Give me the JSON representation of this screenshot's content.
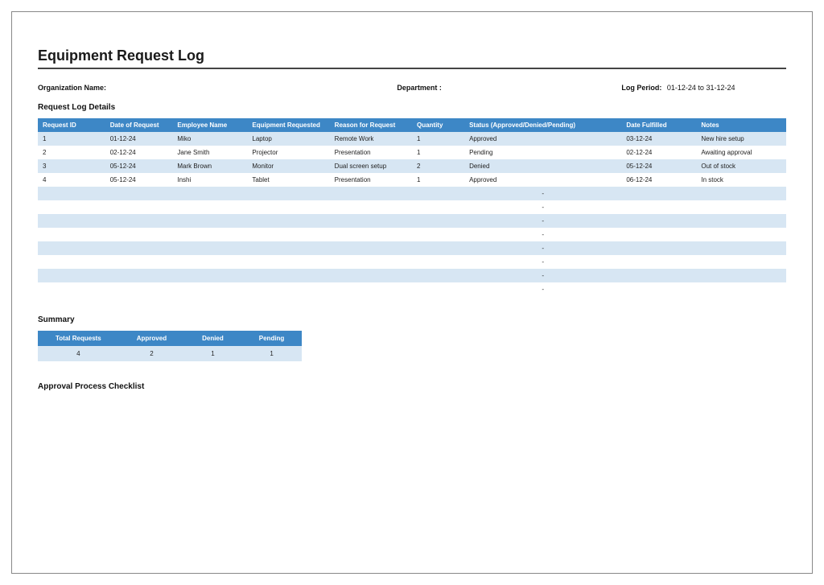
{
  "title": "Equipment Request Log",
  "info": {
    "org_label": "Organization Name:",
    "org_value": "",
    "dept_label": "Department :",
    "dept_value": "",
    "period_label": "Log Period:",
    "period_value": "01-12-24 to 31-12-24"
  },
  "details": {
    "section_title": "Request Log Details",
    "headers": [
      "Request ID",
      "Date of Request",
      "Employee Name",
      "Equipment Requested",
      "Reason for Request",
      "Quantity",
      "Status (Approved/Denied/Pending)",
      "Date Fulfilled",
      "Notes"
    ],
    "rows": [
      {
        "id": "1",
        "date": "01-12-24",
        "emp": "Miko",
        "equip": "Laptop",
        "reason": "Remote Work",
        "qty": "1",
        "status": "Approved",
        "fulfilled": "03-12-24",
        "notes": "New hire setup"
      },
      {
        "id": "2",
        "date": "02-12-24",
        "emp": "Jane Smith",
        "equip": "Projector",
        "reason": "Presentation",
        "qty": "1",
        "status": "Pending",
        "fulfilled": "02-12-24",
        "notes": "Awaiting approval"
      },
      {
        "id": "3",
        "date": "05-12-24",
        "emp": "Mark Brown",
        "equip": "Monitor",
        "reason": "Dual screen setup",
        "qty": "2",
        "status": "Denied",
        "fulfilled": "05-12-24",
        "notes": "Out of stock"
      },
      {
        "id": "4",
        "date": "05-12-24",
        "emp": "Inshi",
        "equip": "Tablet",
        "reason": "Presentation",
        "qty": "1",
        "status": "Approved",
        "fulfilled": "06-12-24",
        "notes": "In stock"
      },
      {
        "id": "",
        "date": "",
        "emp": "",
        "equip": "",
        "reason": "",
        "qty": "",
        "status": "-",
        "fulfilled": "",
        "notes": ""
      },
      {
        "id": "",
        "date": "",
        "emp": "",
        "equip": "",
        "reason": "",
        "qty": "",
        "status": "-",
        "fulfilled": "",
        "notes": ""
      },
      {
        "id": "",
        "date": "",
        "emp": "",
        "equip": "",
        "reason": "",
        "qty": "",
        "status": "-",
        "fulfilled": "",
        "notes": ""
      },
      {
        "id": "",
        "date": "",
        "emp": "",
        "equip": "",
        "reason": "",
        "qty": "",
        "status": "-",
        "fulfilled": "",
        "notes": ""
      },
      {
        "id": "",
        "date": "",
        "emp": "",
        "equip": "",
        "reason": "",
        "qty": "",
        "status": "-",
        "fulfilled": "",
        "notes": ""
      },
      {
        "id": "",
        "date": "",
        "emp": "",
        "equip": "",
        "reason": "",
        "qty": "",
        "status": "-",
        "fulfilled": "",
        "notes": ""
      },
      {
        "id": "",
        "date": "",
        "emp": "",
        "equip": "",
        "reason": "",
        "qty": "",
        "status": "-",
        "fulfilled": "",
        "notes": ""
      },
      {
        "id": "",
        "date": "",
        "emp": "",
        "equip": "",
        "reason": "",
        "qty": "",
        "status": "-",
        "fulfilled": "",
        "notes": ""
      }
    ]
  },
  "summary": {
    "section_title": "Summary",
    "headers": [
      "Total Requests",
      "Approved",
      "Denied",
      "Pending"
    ],
    "values": [
      "4",
      "2",
      "1",
      "1"
    ]
  },
  "checklist_title": "Approval Process Checklist"
}
